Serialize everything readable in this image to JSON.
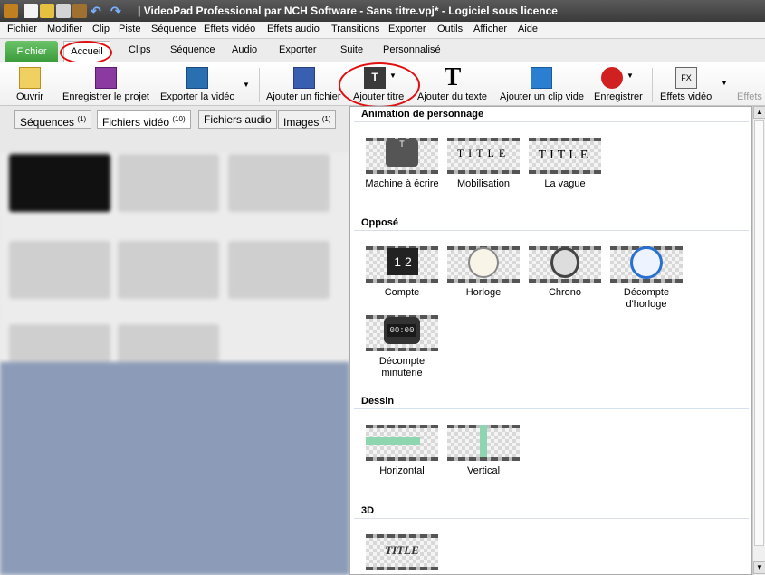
{
  "window": {
    "title": "| VideoPad Professional par NCH Software - Sans titre.vpj* - Logiciel sous licence"
  },
  "menu": [
    "Fichier",
    "Modifier",
    "Clip",
    "Piste",
    "Séquence",
    "Effets vidéo",
    "Effets audio",
    "Transitions",
    "Exporter",
    "Outils",
    "Afficher",
    "Aide"
  ],
  "tabs": {
    "fichier": "Fichier",
    "accueil": "Accueil",
    "others": [
      "Clips",
      "Séquence",
      "Audio",
      "Exporter",
      "Suite",
      "Personnalisé"
    ]
  },
  "ribbon": [
    "Ouvrir",
    "Enregistrer le projet",
    "Exporter la vidéo",
    "Ajouter un fichier",
    "Ajouter titre",
    "Ajouter du texte",
    "Ajouter un clip vide",
    "Enregistrer",
    "Effets vidéo",
    "Effets"
  ],
  "panel_tabs": [
    {
      "label": "Séquences",
      "count": "(1)"
    },
    {
      "label": "Fichiers vidéo",
      "count": "(10)"
    },
    {
      "label": "Fichiers audio",
      "count": ""
    },
    {
      "label": "Images",
      "count": "(1)"
    }
  ],
  "dropdown": {
    "sections": [
      {
        "title": "Animation de personnage",
        "items": [
          "Machine à écrire",
          "Mobilisation",
          "La vague"
        ]
      },
      {
        "title": "Opposé",
        "items": [
          "Compte",
          "Horloge",
          "Chrono",
          "Décompte d'horloge",
          "Décompte minuterie"
        ]
      },
      {
        "title": "Dessin",
        "items": [
          "Horizontal",
          "Vertical"
        ]
      },
      {
        "title": "3D",
        "items": [
          ""
        ]
      }
    ],
    "thumb_text": {
      "title": "TITLE",
      "title_small": "TITLE",
      "counter": "00:00"
    }
  },
  "colors": {
    "accent_green": "#3a9a38",
    "highlight_red": "#e01010"
  }
}
